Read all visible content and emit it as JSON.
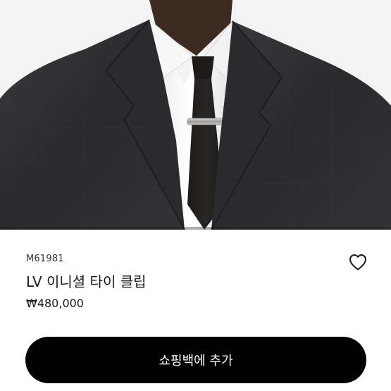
{
  "product": {
    "sku": "M61981",
    "name": "LV 이니셜 타이 클립",
    "price": "₩480,000"
  },
  "actions": {
    "add_to_cart_label": "쇼핑백에 추가",
    "wishlist_icon": "heart-outline-icon"
  },
  "colors": {
    "primary_button": "#000000",
    "button_text": "#ffffff",
    "text": "#1a1a1a"
  }
}
